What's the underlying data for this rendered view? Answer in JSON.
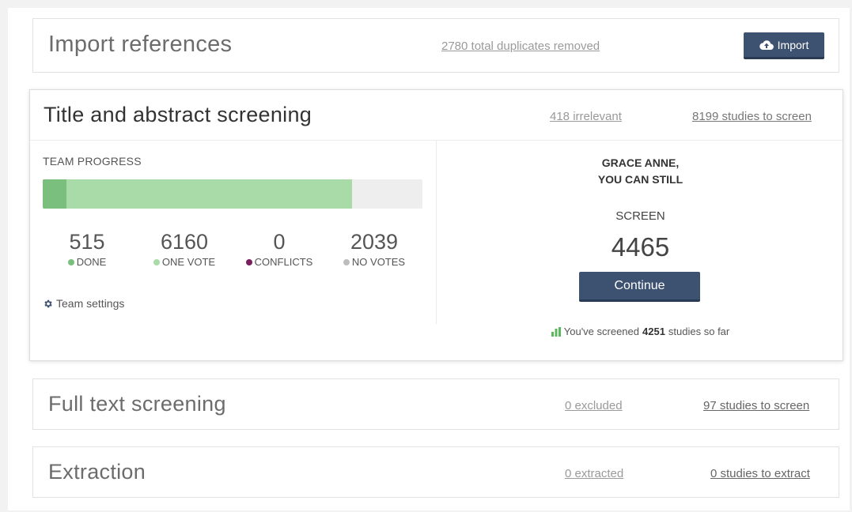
{
  "import": {
    "title": "Import references",
    "duplicates_link": "2780 total duplicates removed",
    "import_button": "Import"
  },
  "screening": {
    "title": "Title and abstract screening",
    "irrelevant_link": "418 irrelevant",
    "studies_link": "8199 studies to screen",
    "team_progress_label": "TEAM PROGRESS",
    "progress": {
      "done_fraction": 0.063,
      "one_vote_fraction": 0.751
    },
    "stats": [
      {
        "value": "515",
        "label": "DONE",
        "color": "#7bbf7e"
      },
      {
        "value": "6160",
        "label": "ONE VOTE",
        "color": "#a9dba8"
      },
      {
        "value": "0",
        "label": "CONFLICTS",
        "color": "#7b1f5c"
      },
      {
        "value": "2039",
        "label": "NO VOTES",
        "color": "#bdbdbd"
      }
    ],
    "team_settings": "Team settings",
    "user_line1": "GRACE ANNE,",
    "user_line2": "YOU CAN STILL",
    "screen_label": "SCREEN",
    "remaining_count": "4465",
    "continue_button": "Continue",
    "summary_prefix": "You've screened",
    "summary_count": "4251",
    "summary_suffix": "studies so far"
  },
  "fulltext": {
    "title": "Full text screening",
    "excluded_link": "0 excluded",
    "studies_link": "97 studies to screen"
  },
  "extraction": {
    "title": "Extraction",
    "extracted_link": "0 extracted",
    "studies_link": "0 studies to extract"
  },
  "colors": {
    "button": "#3d5170",
    "done": "#7bbf7e",
    "one_vote": "#a9dba8",
    "conflicts": "#7b1f5c",
    "no_votes": "#bdbdbd",
    "chart_icon": "#5cb85c"
  },
  "icons": {
    "import": "cloud-upload-icon",
    "settings": "gear-icon",
    "summary": "bar-chart-icon"
  }
}
